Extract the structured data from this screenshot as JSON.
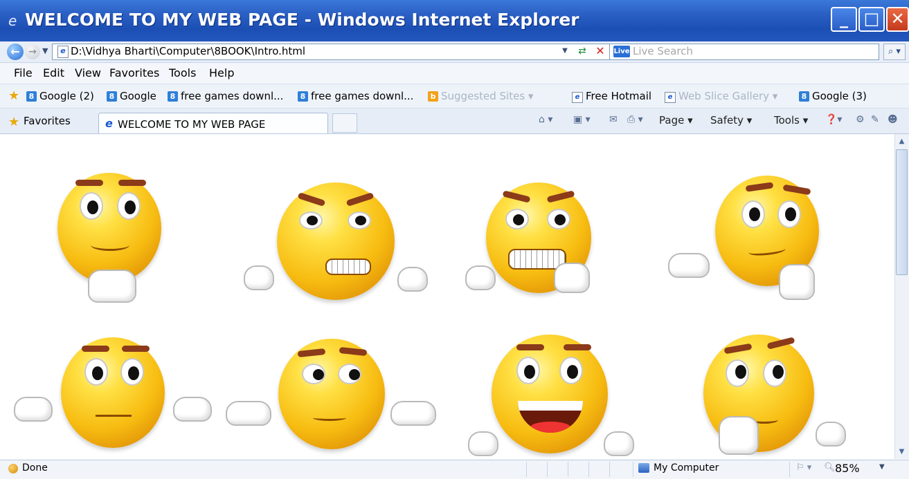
{
  "window": {
    "title": "WELCOME TO MY WEB PAGE - Windows Internet Explorer",
    "buttons": {
      "minimize": "_",
      "maximize": "□",
      "close": "✕"
    }
  },
  "address_bar": {
    "url": "D:\\Vidhya Bharti\\Computer\\8BOOK\\Intro.html",
    "search_placeholder": "Live Search"
  },
  "menu": [
    "File",
    "Edit",
    "View",
    "Favorites",
    "Tools",
    "Help"
  ],
  "links_bar": {
    "items": [
      {
        "label": "Google (2)",
        "icon": "google-icon",
        "dim": false
      },
      {
        "label": "Google",
        "icon": "google-icon",
        "dim": false
      },
      {
        "label": "free games downl...",
        "icon": "google-icon",
        "dim": false
      },
      {
        "label": "free games downl...",
        "icon": "google-icon",
        "dim": false
      },
      {
        "label": "Suggested Sites ▾",
        "icon": "bing-icon",
        "dim": true
      },
      {
        "label": "Free Hotmail",
        "icon": "ie-page-icon",
        "dim": false
      },
      {
        "label": "Web Slice Gallery ▾",
        "icon": "ie-page-icon",
        "dim": true
      },
      {
        "label": "Google (3)",
        "icon": "google-icon",
        "dim": false
      }
    ]
  },
  "tabs": {
    "favorites_label": "Favorites",
    "active_tab": "WELCOME TO MY WEB PAGE"
  },
  "command_bar": {
    "page": "Page ▾",
    "safety": "Safety ▾",
    "tools": "Tools ▾"
  },
  "content": {
    "emoticons": [
      {
        "name": "relaxed-smiley-icon"
      },
      {
        "name": "angry-smiley-icon"
      },
      {
        "name": "grimacing-smiley-icon"
      },
      {
        "name": "thinking-smiley-icon"
      },
      {
        "name": "shrugging-smiley-icon"
      },
      {
        "name": "doubtful-smiley-icon"
      },
      {
        "name": "grinning-smiley-icon"
      },
      {
        "name": "pondering-smiley-icon"
      }
    ]
  },
  "status_bar": {
    "status": "Done",
    "zone": "My Computer",
    "zoom": "85%"
  },
  "colors": {
    "titlebar": "#2a5fc4",
    "close_button": "#c43a1c",
    "face_yellow": "#f7bc11",
    "brow_brown": "#8b3a1a"
  }
}
